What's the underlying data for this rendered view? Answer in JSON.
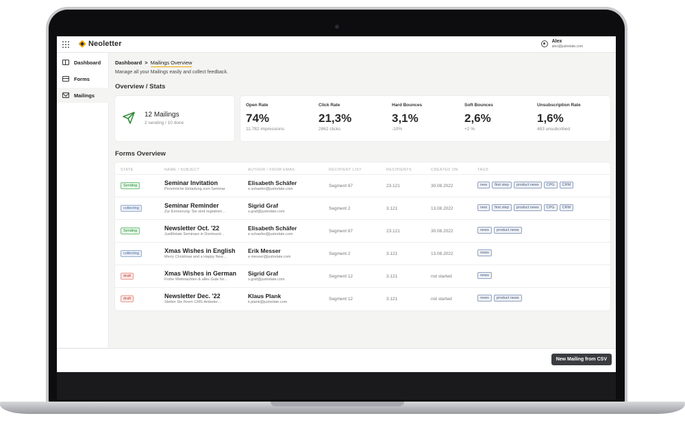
{
  "app": {
    "logo": "Neoletter"
  },
  "user": {
    "name": "Alex",
    "email": "alex@justrelate.com"
  },
  "sidebar": {
    "items": [
      {
        "label": "Dashboard",
        "icon": "dashboard-icon"
      },
      {
        "label": "Forms",
        "icon": "forms-icon"
      },
      {
        "label": "Mailings",
        "icon": "mail-icon"
      }
    ]
  },
  "breadcrumb": {
    "root": "Dashboard",
    "separator": ">",
    "current": "Mailings Overview"
  },
  "page": {
    "subtitle": "Manage all your Mailings easily and collect feedback."
  },
  "overview": {
    "title": "Overview / Stats",
    "mailings_count": "12 Mailings",
    "mailings_sub": "2 sending / 10 done",
    "stats": [
      {
        "label": "Open Rate",
        "value": "74%",
        "sub": "11.782 impressions"
      },
      {
        "label": "Click Rate",
        "value": "21,3%",
        "sub": "2862 clicks"
      },
      {
        "label": "Hard Bounces",
        "value": "3,1%",
        "sub": "-10%"
      },
      {
        "label": "Soft Bounces",
        "value": "2,6%",
        "sub": "+2 %"
      },
      {
        "label": "Unsubscription Rate",
        "value": "1,6%",
        "sub": "483 unsubcribed"
      }
    ]
  },
  "forms": {
    "title": "Forms Overview",
    "headers": [
      "STATE",
      "NAME / SUBJECT",
      "AUTHOR / FROM EMAIL",
      "RECIPIENT LIST",
      "RECIPIENTS",
      "CREATED ON",
      "TAGS"
    ],
    "rows": [
      {
        "state": "Sending",
        "name": "Seminar Invitation",
        "subject": "Persönliche Einladung zum Seminar",
        "author": "Elisabeth Schäfer",
        "email": "e.schaefer@justrelate.com",
        "list": "Segment 67",
        "recipients": "23.121",
        "created": "30.08.2022",
        "tags": [
          "new",
          "first step",
          "product news",
          "CPG",
          "CRM"
        ]
      },
      {
        "state": "collecting",
        "name": "Seminar Reminder",
        "subject": "Zur Erinnerung: Sie sind registriert…",
        "author": "Sigrid Graf",
        "email": "s.graf@justrelate.com",
        "list": "Segment 2",
        "recipients": "3.121",
        "created": "13.08.2022",
        "tags": [
          "new",
          "first step",
          "product news",
          "CPG",
          "CRM"
        ]
      },
      {
        "state": "Sending",
        "name": "Newsletter Oct. '22",
        "subject": "JustRelate Seminare in Dortmund…",
        "author": "Elisabeth Schäfer",
        "email": "e.schaefer@justrelate.com",
        "list": "Segment 67",
        "recipients": "23.121",
        "created": "30.08.2022",
        "tags": [
          "news",
          "product news"
        ]
      },
      {
        "state": "collecting",
        "name": "Xmas Wishes in English",
        "subject": "Merry Christmas and a Happy New…",
        "author": "Erik Messer",
        "email": "e.messer@justrelate.com",
        "list": "Segment 2",
        "recipients": "3.121",
        "created": "13.08.2022",
        "tags": [
          "news"
        ]
      },
      {
        "state": "draft",
        "name": "Xmas Wishes in German",
        "subject": "Frohe Weihnachten & alles Gute für…",
        "author": "Sigrid Graf",
        "email": "s.graf@justrelate.com",
        "list": "Segment 12",
        "recipients": "3.121",
        "created": "not started",
        "tags": [
          "news"
        ]
      },
      {
        "state": "draft",
        "name": "Newsletter Dec. '22",
        "subject": "Stellen Sie Ihrem CMS-Anbieter…",
        "author": "Klaus Plank",
        "email": "k.plank@justrelate.com",
        "list": "Segment 12",
        "recipients": "3.121",
        "created": "not started",
        "tags": [
          "news",
          "product news"
        ]
      }
    ]
  },
  "footer": {
    "button": "New Mailing from CSV"
  },
  "colors": {
    "accent": "#f2a900",
    "sending": "#2e8b3a",
    "collecting": "#4a6a9a",
    "draft": "#c0392b"
  }
}
